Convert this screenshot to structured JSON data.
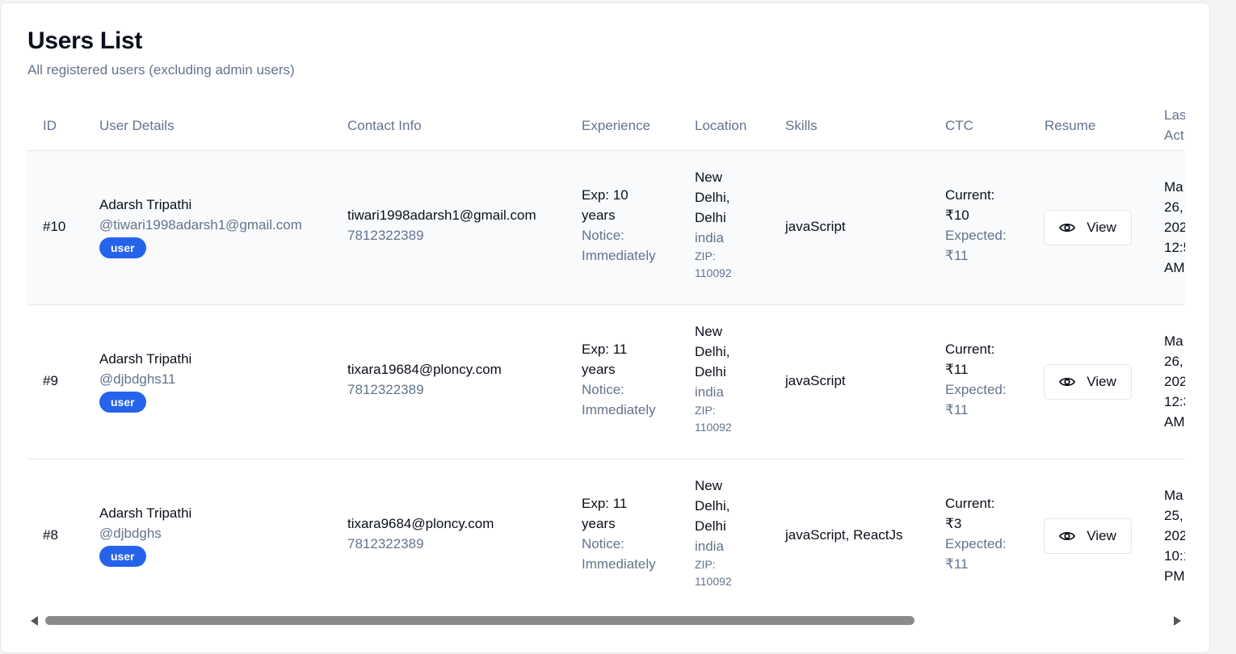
{
  "page": {
    "title": "Users List",
    "subtitle": "All registered users (excluding admin users)"
  },
  "table": {
    "headers": {
      "id": "ID",
      "user_details": "User Details",
      "contact_info": "Contact Info",
      "experience": "Experience",
      "location": "Location",
      "skills": "Skills",
      "ctc": "CTC",
      "resume": "Resume",
      "last_active_1": "Las",
      "last_active_2": "Act"
    },
    "rows": [
      {
        "id": "#10",
        "name": "Adarsh Tripathi",
        "username": "@tiwari1998adarsh1@gmail.com",
        "role": "user",
        "email": "tiwari1998adarsh1@gmail.com",
        "phone": "7812322389",
        "exp_1": "Exp: 10",
        "exp_2": "years",
        "notice_1": "Notice:",
        "notice_2": "Immediately",
        "city_1": "New",
        "city_2": "Delhi,",
        "city_3": "Delhi",
        "country": "india",
        "zip_1": "ZIP:",
        "zip_2": "110092",
        "skills": "javaScript",
        "current_label": "Current:",
        "current_value": "₹10",
        "expected_label": "Expected:",
        "expected_value": "₹11",
        "resume_label": "View",
        "last_1": "Ma",
        "last_2": "26,",
        "last_3": "202",
        "last_4": "12:5",
        "last_5": "AM"
      },
      {
        "id": "#9",
        "name": "Adarsh Tripathi",
        "username": "@djbdghs11",
        "role": "user",
        "email": "tixara19684@ploncy.com",
        "phone": "7812322389",
        "exp_1": "Exp: 11",
        "exp_2": "years",
        "notice_1": "Notice:",
        "notice_2": "Immediately",
        "city_1": "New",
        "city_2": "Delhi,",
        "city_3": "Delhi",
        "country": "india",
        "zip_1": "ZIP:",
        "zip_2": "110092",
        "skills": "javaScript",
        "current_label": "Current:",
        "current_value": "₹11",
        "expected_label": "Expected:",
        "expected_value": "₹11",
        "resume_label": "View",
        "last_1": "Ma",
        "last_2": "26,",
        "last_3": "202",
        "last_4": "12:3",
        "last_5": "AM"
      },
      {
        "id": "#8",
        "name": "Adarsh Tripathi",
        "username": "@djbdghs",
        "role": "user",
        "email": "tixara9684@ploncy.com",
        "phone": "7812322389",
        "exp_1": "Exp: 11",
        "exp_2": "years",
        "notice_1": "Notice:",
        "notice_2": "Immediately",
        "city_1": "New",
        "city_2": "Delhi,",
        "city_3": "Delhi",
        "country": "india",
        "zip_1": "ZIP:",
        "zip_2": "110092",
        "skills": "javaScript, ReactJs",
        "current_label": "Current:",
        "current_value": "₹3",
        "expected_label": "Expected:",
        "expected_value": "₹11",
        "resume_label": "View",
        "last_1": "Ma",
        "last_2": "25,",
        "last_3": "202",
        "last_4": "10:1",
        "last_5": "PM"
      }
    ]
  },
  "icons": {
    "resume_view": "eye-icon",
    "scroll_left": "scroll-left-arrow-icon",
    "scroll_right": "scroll-right-arrow-icon"
  },
  "colors": {
    "badge": "#2563eb",
    "muted_text": "#64748b",
    "row_highlight": "#f8fafc"
  }
}
